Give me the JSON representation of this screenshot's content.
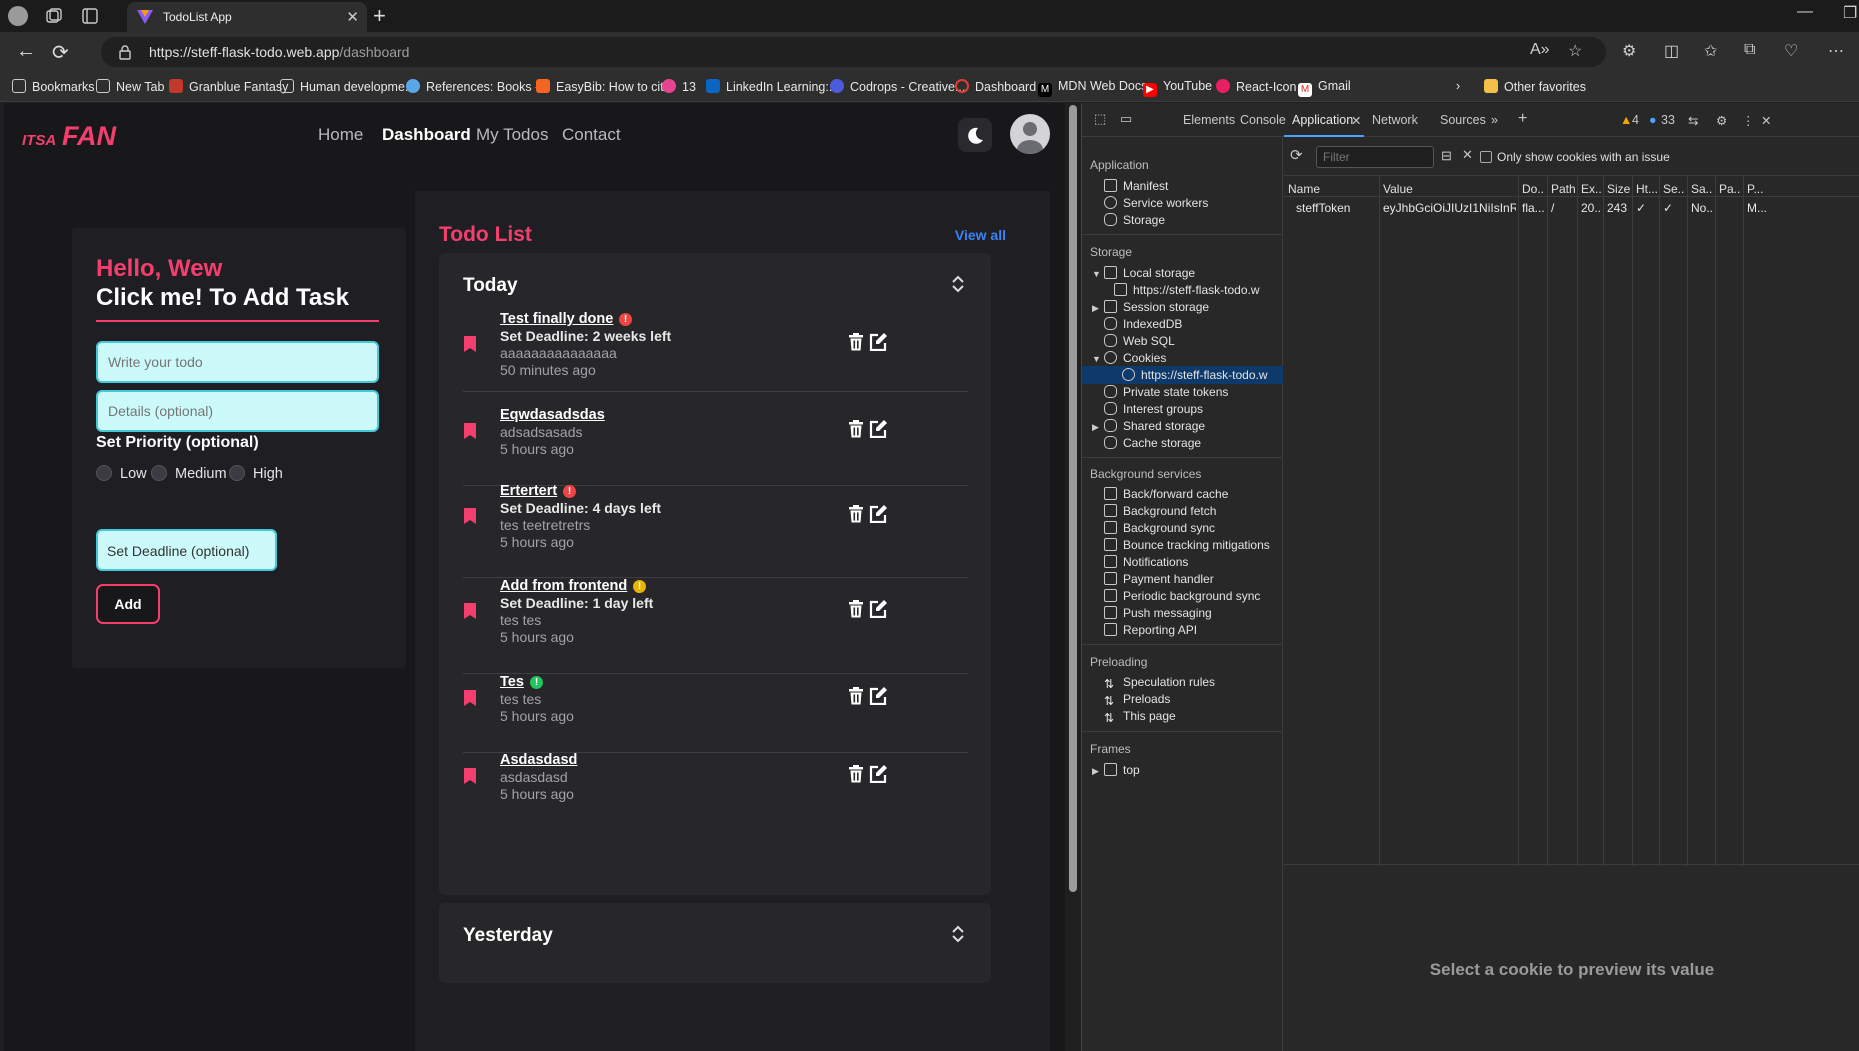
{
  "browser": {
    "tab_title": "TodoList App",
    "url_host": "https://steff-flask-todo.web.app",
    "url_path": "/dashboard",
    "bookmarks": [
      {
        "label": "Bookmarks",
        "icon": "bookmarks-icon"
      },
      {
        "label": "New Tab",
        "icon": "page-icon"
      },
      {
        "label": "Granblue Fantasy",
        "icon": "granblue-icon"
      },
      {
        "label": "Human developme...",
        "icon": "page-icon"
      },
      {
        "label": "References: Books -...",
        "icon": "cloud-icon"
      },
      {
        "label": "EasyBib: How to cit...",
        "icon": "easybib-icon"
      },
      {
        "label": "13",
        "icon": "circle-icon"
      },
      {
        "label": "LinkedIn Learning:...",
        "icon": "linkedin-icon"
      },
      {
        "label": "Codrops - Creative...",
        "icon": "codrops-icon"
      },
      {
        "label": "Dashboard",
        "icon": "ring-icon"
      },
      {
        "label": "MDN Web Docs",
        "icon": "mdn-icon"
      },
      {
        "label": "YouTube",
        "icon": "youtube-icon"
      },
      {
        "label": "React-Icon",
        "icon": "react-icon"
      },
      {
        "label": "Gmail",
        "icon": "gmail-icon"
      }
    ],
    "other_favorites": "Other favorites"
  },
  "app": {
    "nav": [
      "Home",
      "Dashboard",
      "My Todos",
      "Contact"
    ],
    "greeting": "Hello, Wew",
    "add_title": "Click me! To Add Task",
    "todo_placeholder": "Write your todo",
    "details_placeholder": "Details (optional)",
    "priority_label": "Set Priority (optional)",
    "priorities": [
      "Low",
      "Medium",
      "High"
    ],
    "deadline_button": "Set Deadline (optional)",
    "add_button": "Add",
    "list_title": "Todo List",
    "view_all": "View all",
    "today_label": "Today",
    "yesterday_label": "Yesterday",
    "items": [
      {
        "title": "Test finally done",
        "priority": "high",
        "deadline": "Set Deadline: 2 weeks left",
        "details": "aaaaaaaaaaaaaaa",
        "time": "50 minutes ago"
      },
      {
        "title": "Eqwdasadsdas",
        "priority": "",
        "deadline": "",
        "details": "adsadsasads",
        "time": "5 hours ago"
      },
      {
        "title": "Ertertert",
        "priority": "high",
        "deadline": "Set Deadline: 4 days left",
        "details": "tes teetretretrs",
        "time": "5 hours ago"
      },
      {
        "title": "Add from frontend",
        "priority": "medium",
        "deadline": "Set Deadline: 1 day left",
        "details": "tes tes",
        "time": "5 hours ago"
      },
      {
        "title": "Tes",
        "priority": "low",
        "deadline": "",
        "details": "tes tes",
        "time": "5 hours ago"
      },
      {
        "title": "Asdasdasd",
        "priority": "",
        "deadline": "",
        "details": "asdasdasd",
        "time": "5 hours ago"
      }
    ],
    "colors": {
      "accent": "#f43f6e",
      "high": "#ef4444",
      "medium": "#eab308",
      "low": "#22c55e",
      "link": "#3b82f6"
    }
  },
  "devtools": {
    "tabs": [
      "Elements",
      "Console",
      "Application",
      "Network",
      "Sources"
    ],
    "warnings": "4",
    "messages": "33",
    "sections": {
      "application": "Application",
      "storage": "Storage",
      "background": "Background services",
      "preloading": "Preloading",
      "frames": "Frames"
    },
    "app_items": [
      "Manifest",
      "Service workers",
      "Storage"
    ],
    "storage_items": [
      "Local storage",
      "https://steff-flask-todo.w",
      "Session storage",
      "IndexedDB",
      "Web SQL",
      "Cookies",
      "https://steff-flask-todo.w",
      "Private state tokens",
      "Interest groups",
      "Shared storage",
      "Cache storage"
    ],
    "bg_items": [
      "Back/forward cache",
      "Background fetch",
      "Background sync",
      "Bounce tracking mitigations",
      "Notifications",
      "Payment handler",
      "Periodic background sync",
      "Push messaging",
      "Reporting API"
    ],
    "preload_items": [
      "Speculation rules",
      "Preloads",
      "This page"
    ],
    "frames_items": [
      "top"
    ],
    "filter_placeholder": "Filter",
    "only_issue": "Only show cookies with an issue",
    "columns": [
      "Name",
      "Value",
      "Do...",
      "Path",
      "Ex...",
      "Size",
      "Ht...",
      "Se...",
      "Sa...",
      "Pa...",
      "P..."
    ],
    "cookie": [
      "steffToken",
      "eyJhbGciOiJIUzI1NiIsInR5c...",
      "fla...",
      "/",
      "20...",
      "243",
      "✓",
      "✓",
      "No...",
      "",
      "M..."
    ],
    "preview": "Select a cookie to preview its value"
  }
}
